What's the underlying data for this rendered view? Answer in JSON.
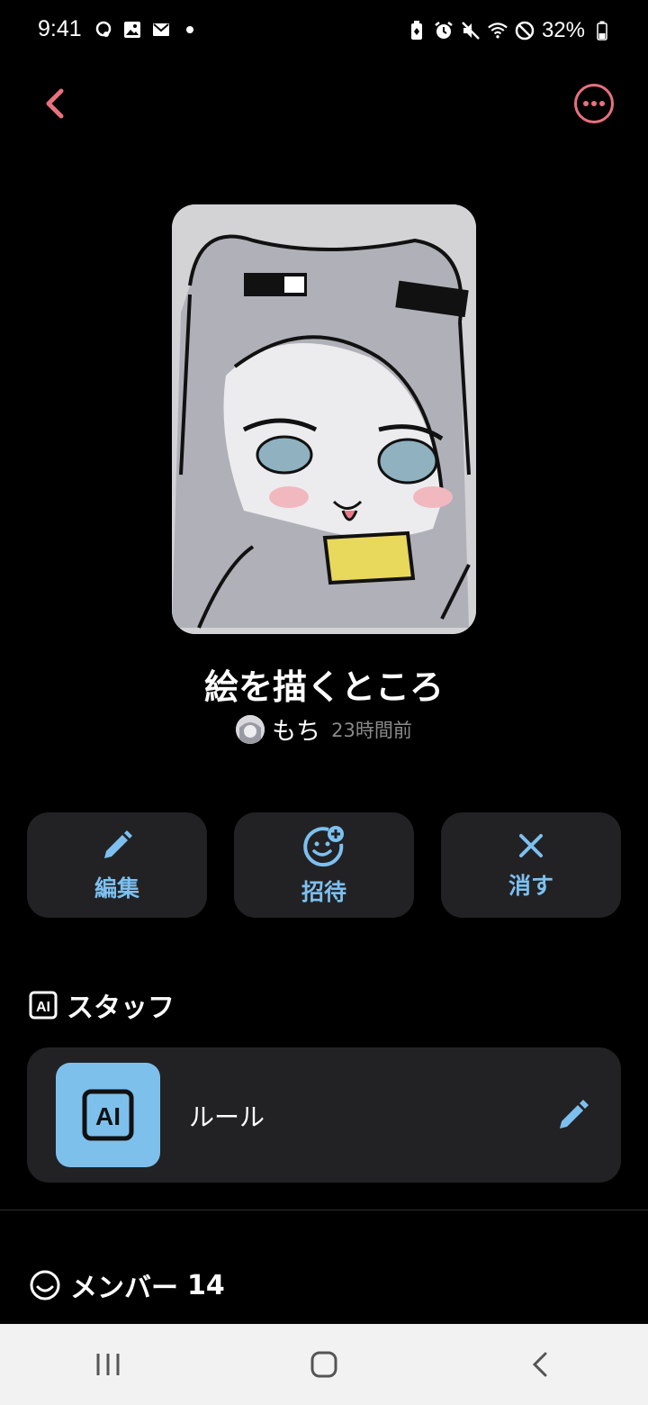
{
  "status_bar": {
    "time": "9:41",
    "battery": "32%",
    "left_icons": [
      "assistant-icon",
      "image-icon",
      "mail-icon",
      "dot-icon"
    ],
    "right_icons": [
      "battery-saver-icon",
      "alarm-icon",
      "mute-icon",
      "wifi-icon",
      "dnd-icon",
      "battery-icon"
    ]
  },
  "header": {
    "back_icon": "chevron-left-icon",
    "more_icon": "more-icon",
    "accent_color": "#e8707f"
  },
  "room": {
    "title": "絵を描くところ",
    "author": "もち",
    "posted": "23時間前"
  },
  "actions": [
    {
      "label": "編集",
      "icon": "pencil-icon"
    },
    {
      "label": "招待",
      "icon": "invite-icon"
    },
    {
      "label": "消す",
      "icon": "close-icon"
    }
  ],
  "staff_section": {
    "title": "スタッフ",
    "icon": "ai-icon",
    "items": [
      {
        "name": "ルール",
        "badge": "AI"
      }
    ]
  },
  "members_section": {
    "title": "メンバー",
    "count": "14",
    "icon": "smile-icon"
  },
  "nav": {
    "items": [
      "recents-icon",
      "home-icon",
      "back-icon"
    ]
  },
  "colors": {
    "accent_blue": "#7dc0f0",
    "card_bg": "#222224"
  }
}
